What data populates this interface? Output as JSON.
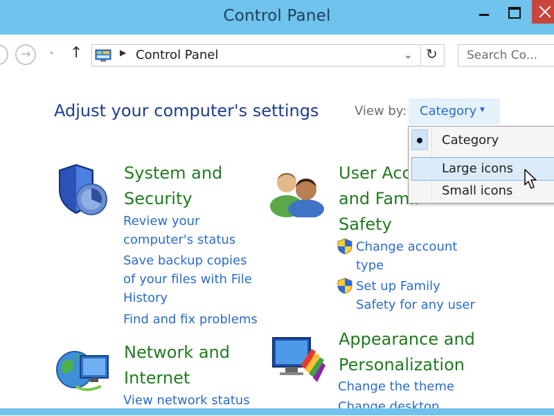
{
  "window": {
    "title": "Control Panel"
  },
  "nav": {
    "address_text": "Control Panel",
    "search_placeholder": "Search Co..."
  },
  "header": {
    "title": "Adjust your computer's settings",
    "view_by_label": "View by:",
    "view_by_value": "Category"
  },
  "view_menu": {
    "options": [
      "Category",
      "Large icons",
      "Small icons"
    ],
    "selected": "Category",
    "hovered": "Large icons"
  },
  "categories": [
    {
      "title_lines": [
        "System and",
        "Security"
      ],
      "icon": "shield-icon",
      "links": [
        {
          "lines": [
            "Review your",
            "computer's status"
          ]
        },
        {
          "lines": [
            "Save backup copies",
            "of your files with File",
            "History"
          ]
        },
        {
          "lines": [
            "Find and fix problems"
          ]
        }
      ]
    },
    {
      "title_lines": [
        "User Acc",
        "and Famil",
        "Safety"
      ],
      "icon": "users-icon",
      "links": [
        {
          "lines": [
            "Change account",
            "type"
          ],
          "uac": true
        },
        {
          "lines": [
            "Set up Family",
            "Safety for any user"
          ],
          "uac": true
        }
      ]
    },
    {
      "title_lines": [
        "Network and",
        "Internet"
      ],
      "icon": "network-icon",
      "links": [
        {
          "lines": [
            "View network status"
          ]
        }
      ]
    },
    {
      "title_lines": [
        "Appearance and",
        "Personalization"
      ],
      "icon": "appearance-icon",
      "links": [
        {
          "lines": [
            "Change the theme"
          ]
        },
        {
          "lines": [
            "Change desktop"
          ]
        }
      ]
    }
  ],
  "colors": {
    "titlebar": "#6fc3ec",
    "heading": "#1e3d8f",
    "category_title": "#217a1e",
    "link": "#2a6ccb",
    "close_button": "#c9443c"
  }
}
